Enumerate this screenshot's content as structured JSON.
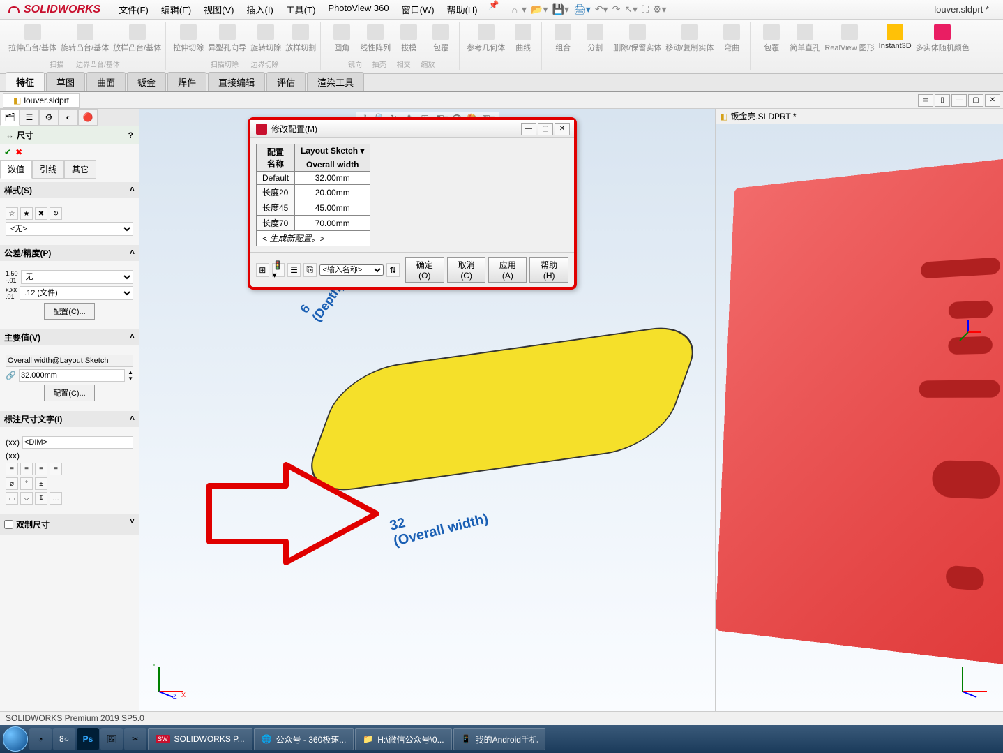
{
  "app": {
    "brand": "SOLIDWORKS",
    "doc_title": "louver.sldprt *"
  },
  "menu": {
    "file": "文件(F)",
    "edit": "编辑(E)",
    "view": "视图(V)",
    "insert": "插入(I)",
    "tools": "工具(T)",
    "photoview": "PhotoView 360",
    "window": "窗口(W)",
    "help": "帮助(H)"
  },
  "ribbon": {
    "items": [
      "拉伸凸台/基体",
      "旋转凸台/基体",
      "放样凸台/基体",
      "拉伸切除",
      "异型孔向导",
      "旋转切除",
      "放样切割",
      "圆角",
      "线性阵列",
      "拔模",
      "包覆",
      "参考几何体",
      "曲线",
      "组合",
      "分割",
      "删除/保留实体",
      "移动/复制实体",
      "弯曲",
      "包覆",
      "简单直孔",
      "RealView 图形",
      "Instant3D",
      "多实体随机颜色"
    ],
    "small": [
      "扫描",
      "边界凸台/基体",
      "扫描切除",
      "边界切除",
      "镜向",
      "抽壳",
      "相交",
      "缩放"
    ]
  },
  "tabs": [
    "特征",
    "草图",
    "曲面",
    "钣金",
    "焊件",
    "直接编辑",
    "评估",
    "渲染工具"
  ],
  "doc_tabs": {
    "left": "louver.sldprt",
    "right": "钣金壳.SLDPRT *"
  },
  "panel": {
    "title": "尺寸",
    "sub_tabs": [
      "数值",
      "引线",
      "其它"
    ],
    "sections": {
      "style": "样式(S)",
      "style_none": "<无>",
      "tolerance": "公差/精度(P)",
      "tol_none": "无",
      "tol_doc": ".12 (文件)",
      "config_btn": "配置(C)...",
      "main_value": "主要值(V)",
      "main_value_name": "Overall width@Layout Sketch",
      "main_value_val": "32.000mm",
      "dim_text": "标注尺寸文字(I)",
      "dim_text_val": "<DIM>",
      "dual": "双制尺寸"
    }
  },
  "dialog": {
    "title": "修改配置(M)",
    "header_col1": "配置\n名称",
    "header_col2": "Layout Sketch",
    "header_col3": "Overall width",
    "rows": [
      {
        "name": "Default",
        "value": "32.00mm"
      },
      {
        "name": "长度20",
        "value": "20.00mm"
      },
      {
        "name": "长度45",
        "value": "45.00mm"
      },
      {
        "name": "长度70",
        "value": "70.00mm"
      }
    ],
    "new_config": "< 生成新配置。>",
    "input_placeholder": "<输入名称>",
    "ok": "确定(O)",
    "cancel": "取消(C)",
    "apply": "应用(A)",
    "help": "帮助(H)"
  },
  "viewport": {
    "dim_depth": "6\n(Depth)",
    "dim_width": "32\n(Overall width)"
  },
  "status": "SOLIDWORKS Premium 2019 SP5.0",
  "taskbar": {
    "items": [
      "SOLIDWORKS P...",
      "公众号 - 360极速...",
      "H:\\微信公众号\\0...",
      "我的Android手机"
    ]
  }
}
